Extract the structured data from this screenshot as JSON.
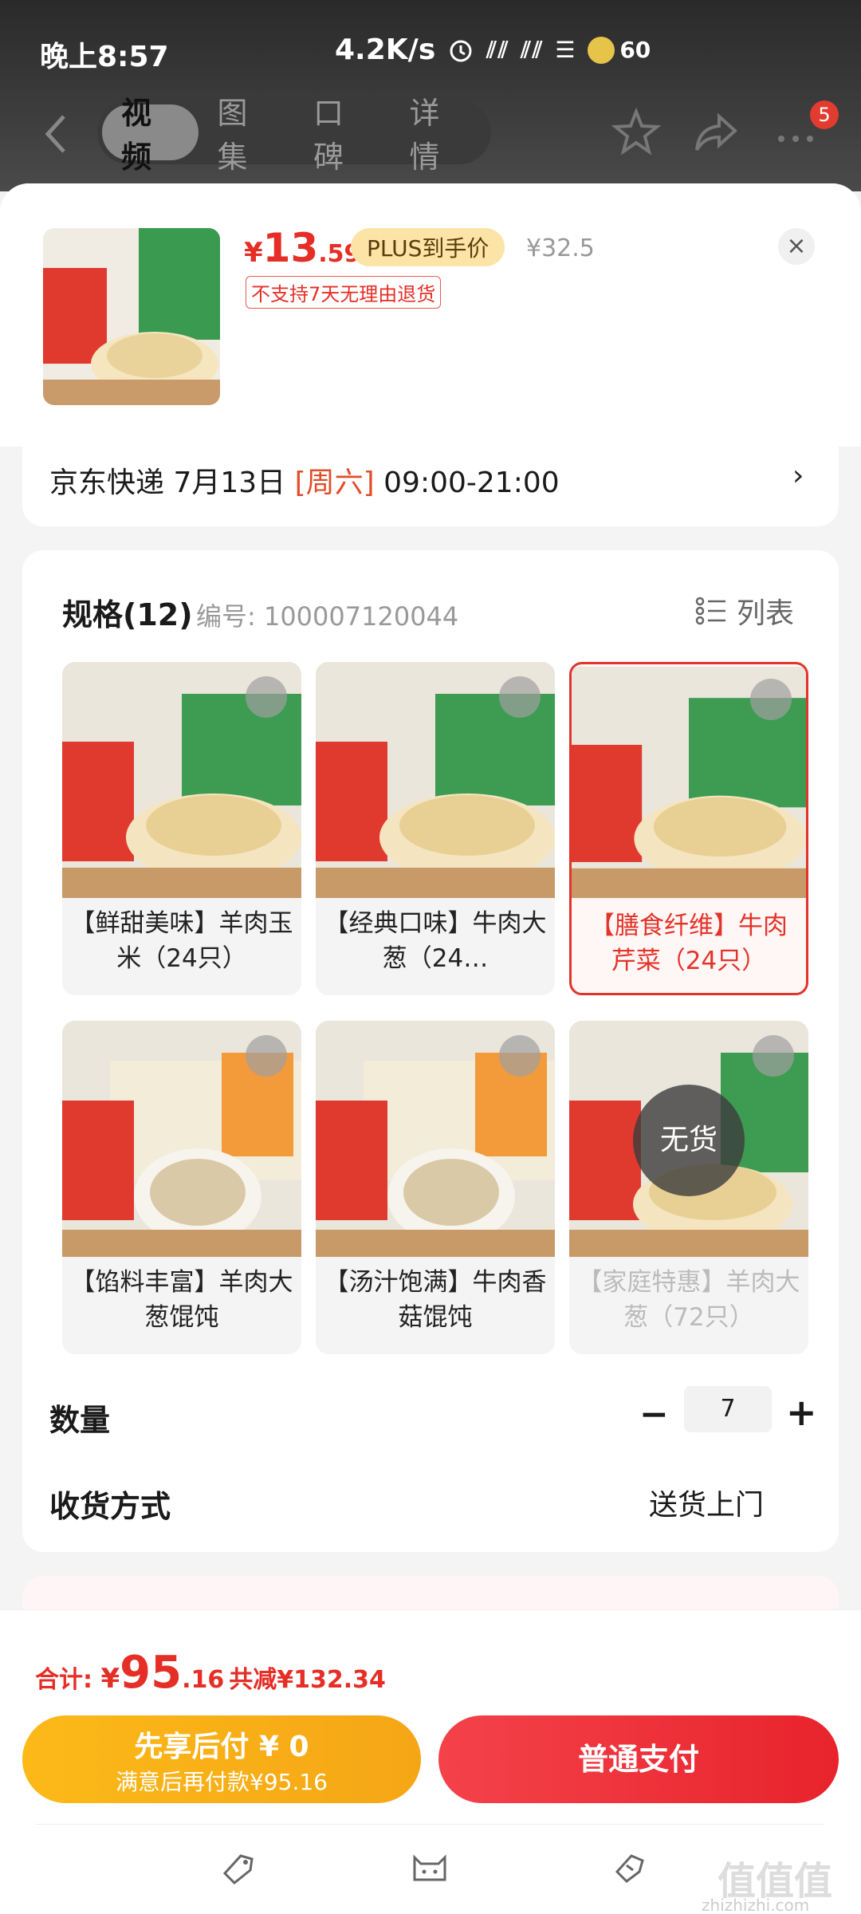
{
  "status": {
    "time": "晚上8:57",
    "speed": "4.2K/s",
    "battery": "60"
  },
  "nav": {
    "tabs": [
      "视频",
      "图集",
      "口碑",
      "详情"
    ],
    "active": 0,
    "badge": "5"
  },
  "product": {
    "currency": "¥",
    "price_int": "13",
    "price_dec": ".59",
    "plus_label": "PLUS到手价",
    "original_price": "¥32.5",
    "return_note": "不支持7天无理由退货",
    "close": "×"
  },
  "shipping": {
    "carrier": "京东快递 7月13日 ",
    "weekday": "[周六]",
    "window": " 09:00-21:00",
    "chevron": "›"
  },
  "spec": {
    "title": "规格(12)",
    "code": "编号: 100007120044",
    "list_label": "列表",
    "items": [
      {
        "label": "【鲜甜美味】羊肉玉米（24只）",
        "state": "normal"
      },
      {
        "label": "【经典口味】牛肉大葱（24…",
        "state": "normal"
      },
      {
        "label": "【膳食纤维】牛肉芹菜（24只）",
        "state": "selected"
      },
      {
        "label": "【馅料丰富】羊肉大葱馄饨",
        "state": "normal"
      },
      {
        "label": "【汤汁饱满】牛肉香菇馄饨",
        "state": "normal"
      },
      {
        "label": "【家庭特惠】羊肉大葱（72只）",
        "state": "out_of_stock",
        "badge": "无货"
      }
    ],
    "quantity_label": "数量",
    "quantity": "7",
    "delivery_label": "收货方式",
    "delivery_value": "送货上门"
  },
  "footer": {
    "total_label": "合计: ",
    "currency": "¥",
    "total_int": "95",
    "total_dec": ".16",
    "discount": "共减¥132.34",
    "later_line1": "先享后付 ¥ 0",
    "later_line2": "满意后再付款¥95.16",
    "pay_label": "普通支付",
    "watermark": "值值值",
    "watermark_url": "zhizhizhi.com"
  },
  "colors": {
    "accent": "#e52e26",
    "gold": "#fcb918"
  }
}
